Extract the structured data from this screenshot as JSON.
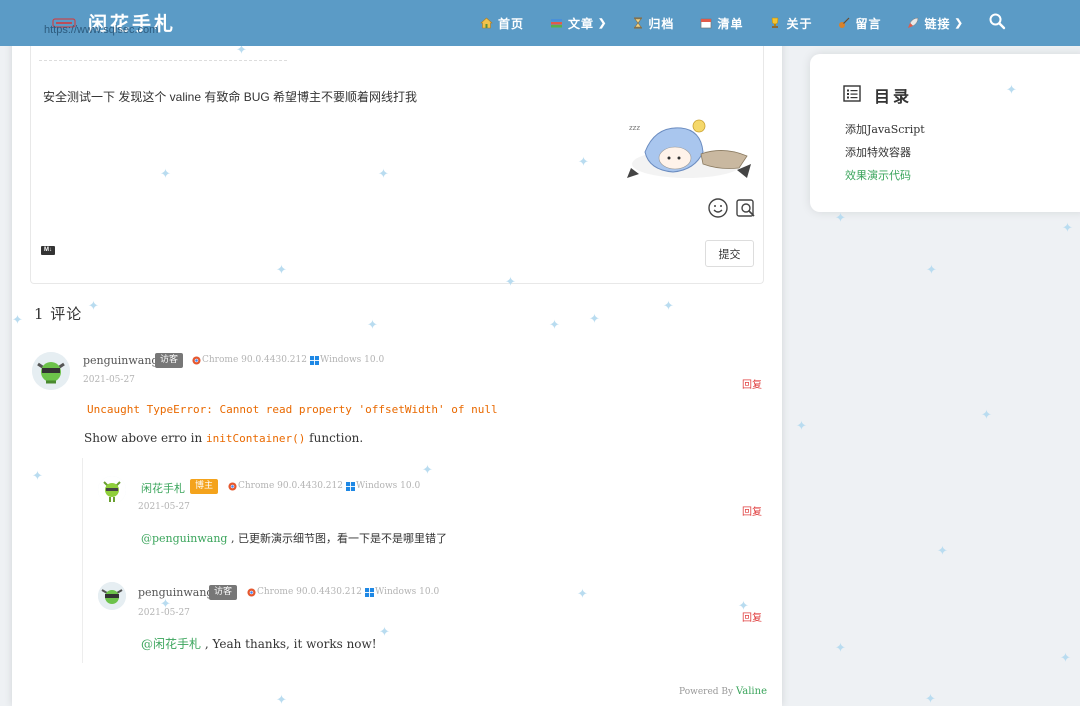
{
  "header": {
    "brand_title": "闲花手札",
    "brand_url": "https://www.sqlsec.com",
    "nav": [
      {
        "label": "首页",
        "icon": "home-icon",
        "dropdown": false
      },
      {
        "label": "文章",
        "icon": "books-icon",
        "dropdown": true
      },
      {
        "label": "归档",
        "icon": "hourglass-icon",
        "dropdown": false
      },
      {
        "label": "清单",
        "icon": "calendar-icon",
        "dropdown": false
      },
      {
        "label": "关于",
        "icon": "trophy-icon",
        "dropdown": false
      },
      {
        "label": "留言",
        "icon": "guitar-icon",
        "dropdown": false
      },
      {
        "label": "链接",
        "icon": "rocket-icon",
        "dropdown": true
      }
    ]
  },
  "editor": {
    "text": "安全测试一下 发现这个 valine 有致命 BUG 希望博主不要顺着网线打我",
    "markdown_icon": "M↓",
    "submit_label": "提交"
  },
  "comments_count": "1 评论",
  "comments": [
    {
      "name": "penguinwang",
      "badge": "访客",
      "browser": "Chrome 90.0.4430.212",
      "os": "Windows 10.0",
      "date": "2021-05-27",
      "reply": "回复",
      "code_line": "Uncaught TypeError: Cannot read property 'offsetWidth' of null",
      "text_before": "Show above erro in ",
      "text_code": "initContainer()",
      "text_after": " function."
    },
    {
      "name": "闲花手札",
      "badge": "博主",
      "browser": "Chrome 90.0.4430.212",
      "os": "Windows 10.0",
      "date": "2021-05-27",
      "reply": "回复",
      "at": "@penguinwang",
      "text": " , 已更新演示细节图，看一下是不是哪里错了"
    },
    {
      "name": "penguinwang",
      "badge": "访客",
      "browser": "Chrome 90.0.4430.212",
      "os": "Windows 10.0",
      "date": "2021-05-27",
      "reply": "回复",
      "at": "@闲花手札",
      "text": " , Yeah thanks, it works now!"
    }
  ],
  "footer": {
    "powered_by": "Powered By",
    "valine": "Valine"
  },
  "toc": {
    "title": "目录",
    "items": [
      {
        "label": "添加JavaScript",
        "active": false
      },
      {
        "label": "添加特效容器",
        "active": false
      },
      {
        "label": "效果演示代码",
        "active": true
      }
    ]
  },
  "colors": {
    "header": "#5b9bc6",
    "accent_green": "#3ba55c",
    "reply_red": "#e04040",
    "code_orange": "#e96900",
    "host_badge": "#f4a31c"
  }
}
